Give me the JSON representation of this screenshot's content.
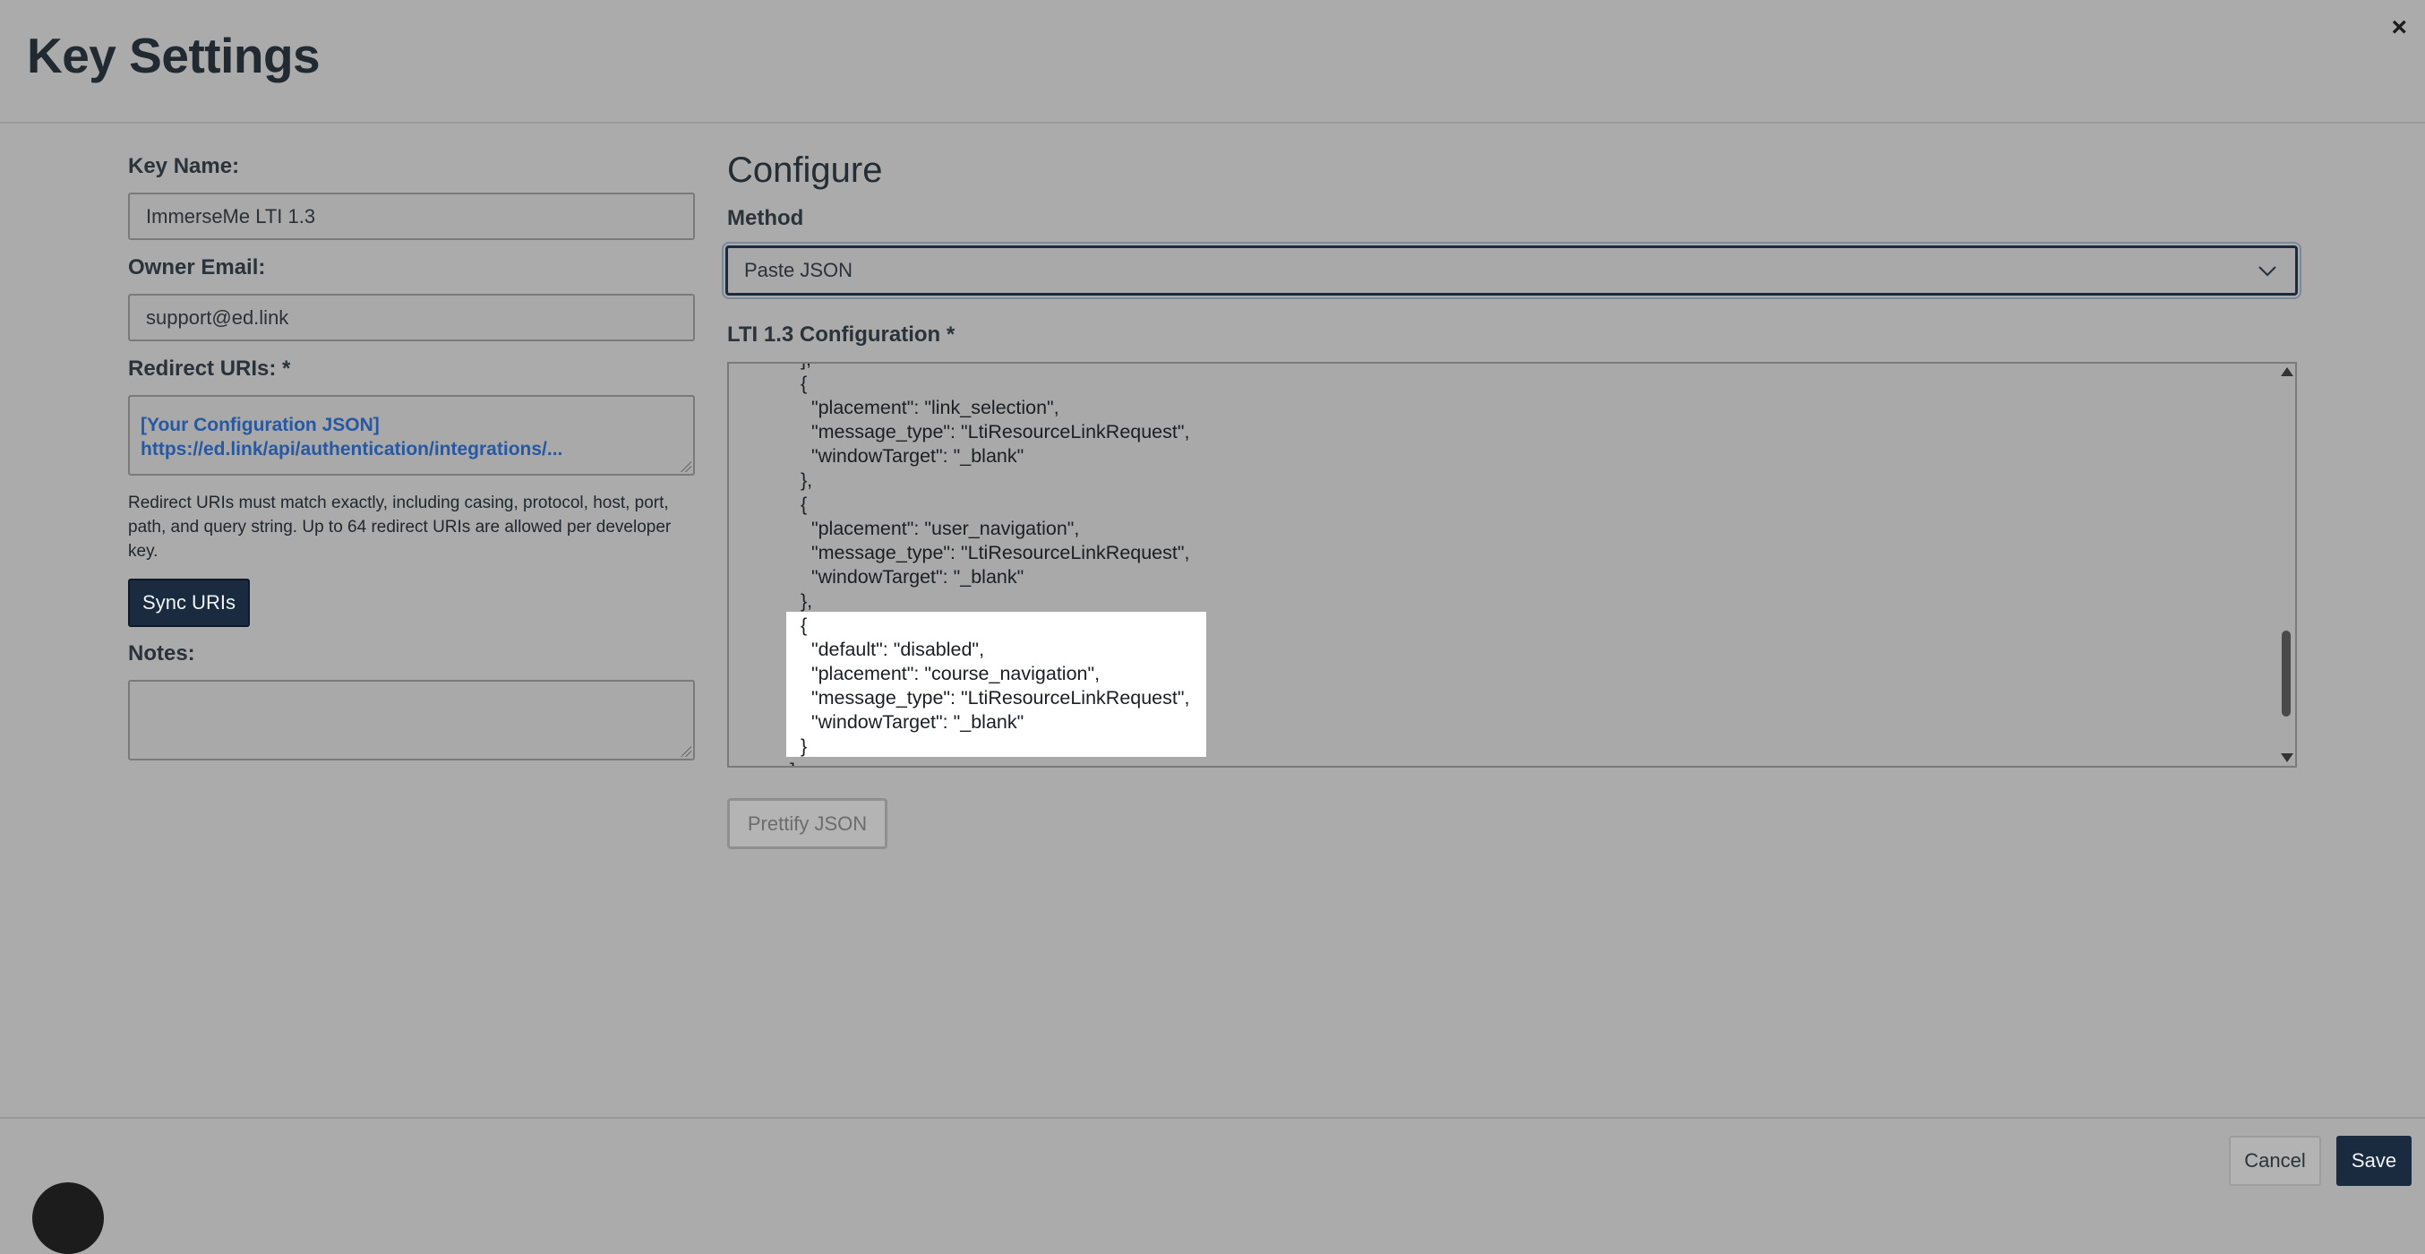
{
  "dialog": {
    "title": "Key Settings",
    "close_icon": "×"
  },
  "form": {
    "key_name": {
      "label": "Key Name:",
      "value": "ImmerseMe LTI 1.3"
    },
    "owner_email": {
      "label": "Owner Email:",
      "value": "support@ed.link"
    },
    "redirect_uris": {
      "label": "Redirect URIs: *",
      "lines": [
        "[Your Configuration JSON]",
        "https://ed.link/api/authentication/integrations/..."
      ],
      "help": "Redirect URIs must match exactly, including casing, protocol, host, port, path, and query string. Up to 64 redirect URIs are allowed per developer key."
    },
    "sync_button": "Sync URIs",
    "notes": {
      "label": "Notes:",
      "value": ""
    }
  },
  "configure": {
    "heading": "Configure",
    "method_label": "Method",
    "method_value": "Paste JSON",
    "config_label": "LTI 1.3 Configuration *",
    "code_lines": [
      "],",
      "{",
      "  \"placement\": \"link_selection\",",
      "  \"message_type\": \"LtiResourceLinkRequest\",",
      "  \"windowTarget\": \"_blank\"",
      "},",
      "{",
      "  \"placement\": \"user_navigation\",",
      "  \"message_type\": \"LtiResourceLinkRequest\",",
      "  \"windowTarget\": \"_blank\"",
      "},",
      "{",
      "  \"default\": \"disabled\",",
      "  \"placement\": \"course_navigation\",",
      "  \"message_type\": \"LtiResourceLinkRequest\",",
      "  \"windowTarget\": \"_blank\"",
      "}",
      "]"
    ],
    "prettify_button": "Prettify JSON"
  },
  "footer": {
    "cancel_label": "Cancel",
    "save_label": "Save"
  }
}
